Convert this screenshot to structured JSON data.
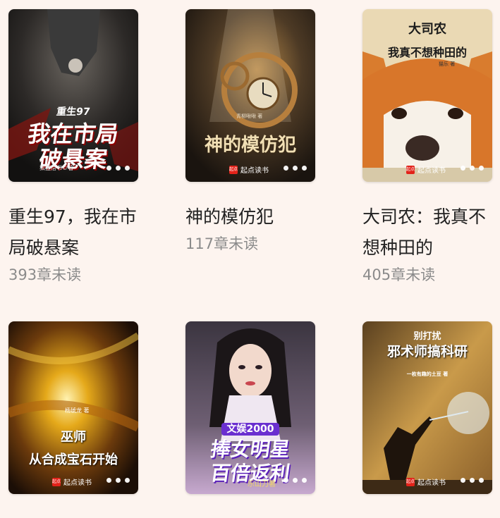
{
  "books": [
    {
      "title": "重生97，我在市局破悬案",
      "unread": "393章未读",
      "cover_title_line1": "重生97",
      "cover_title_line2": "我在市局",
      "cover_title_line3": "破悬案",
      "author": "狐狸信书©著",
      "publisher": ""
    },
    {
      "title": "神的模仿犯",
      "unread": "117章未读",
      "cover_title_line1": "神的模仿犯",
      "author": "青柳啾啾 著",
      "publisher": "起点读书"
    },
    {
      "title": "大司农：我真不想种田的",
      "unread": "405章未读",
      "cover_title_line1": "大司农",
      "cover_title_line2": "我真不想种田的",
      "author": "猫乐 著",
      "publisher": "起点读书"
    },
    {
      "title": "",
      "unread": "",
      "cover_title_line1": "巫师",
      "cover_title_line2": "从合成宝石开始",
      "author": "杨琥龙 著",
      "publisher": "起点读书"
    },
    {
      "title": "",
      "unread": "",
      "cover_title_line1": "文娱2000",
      "cover_title_line2": "捧女明星",
      "cover_title_line3": "百倍返利",
      "author": "乐山刀著",
      "publisher": ""
    },
    {
      "title": "",
      "unread": "",
      "cover_title_line1": "别打扰",
      "cover_title_line2": "邪术师搞科研",
      "author": "一枚有趣的土豆 著",
      "publisher": "起点读书"
    }
  ],
  "colors": {
    "background": "#fdf4ef",
    "title": "#222222",
    "unread": "#8b8b8b",
    "brand": "#e2231a"
  },
  "icons": {
    "more": "more-dots-icon",
    "publisher_logo": "qidian-logo-icon"
  },
  "publisher_logo_text": "起点"
}
